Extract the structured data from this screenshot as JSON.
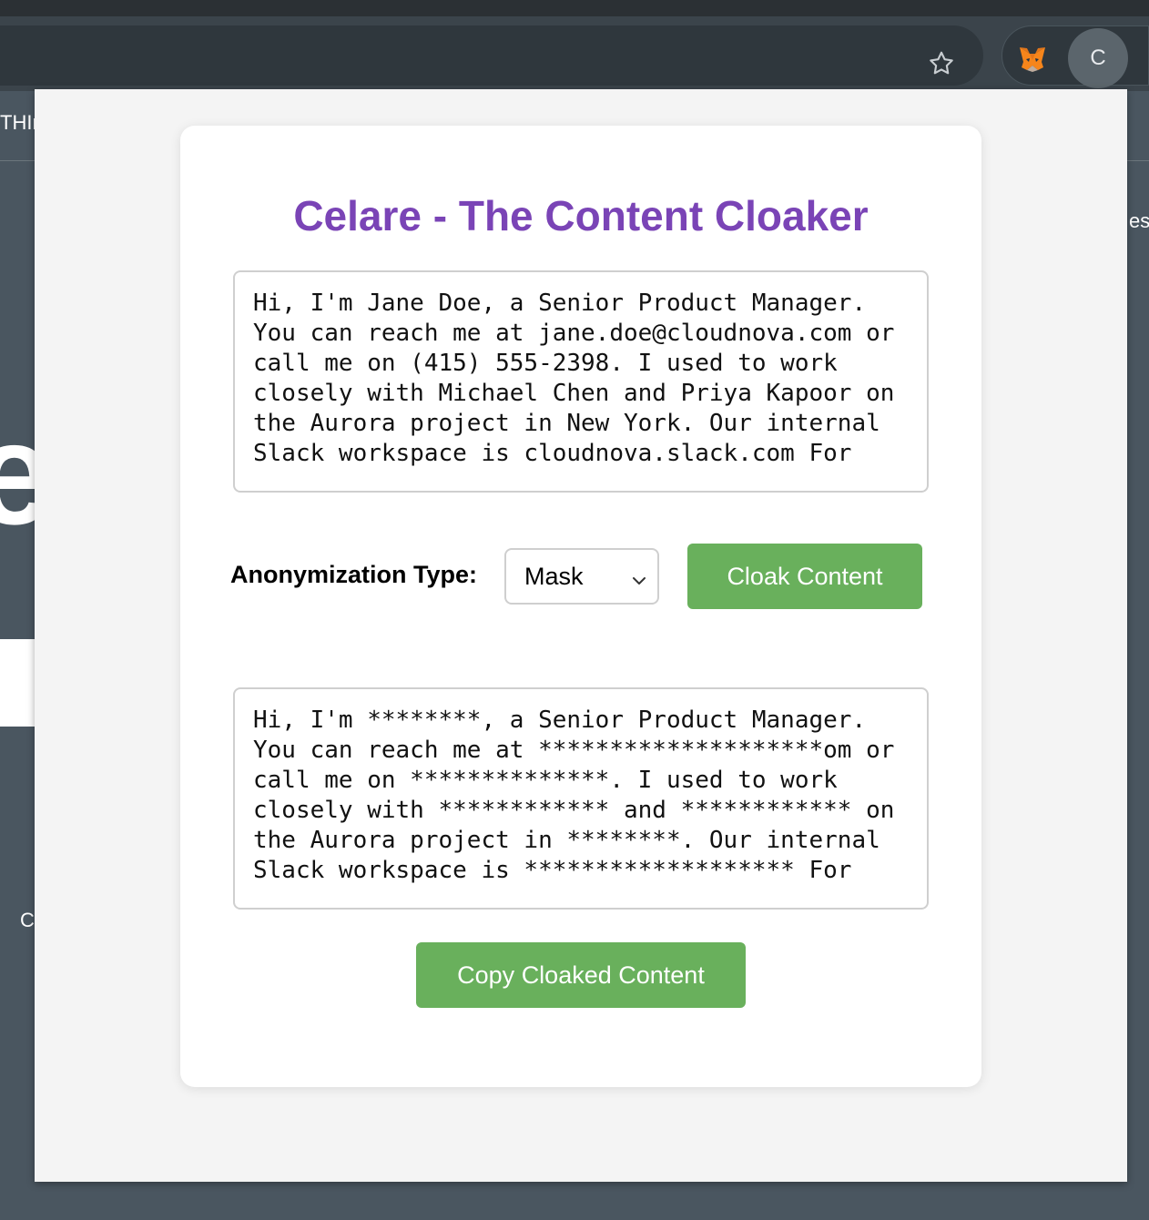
{
  "browser": {
    "avatar_initial": "C",
    "colors": {
      "toolbar": "#3b444b",
      "omnibox": "#2f373d"
    }
  },
  "background": {
    "frag_top_left": "THIr",
    "frag_right": "es",
    "frag_big": "e",
    "frag_bottom_left": "C"
  },
  "app": {
    "title": "Celare - The Content Cloaker",
    "input_text": "Hi, I'm Jane Doe, a Senior Product Manager. You can reach me at jane.doe@cloudnova.com or call me on (415) 555-2398. I used to work closely with Michael Chen and Priya Kapoor on the Aurora project in New York. Our internal Slack workspace is cloudnova.slack.com For",
    "anonymization_label": "Anonymization Type:",
    "anonymization_selected": "Mask",
    "cloak_button": "Cloak Content",
    "output_text": "Hi, I'm ********, a Senior Product Manager. You can reach me at ********************om or call me on **************. I used to work closely with ************ and ************ on the Aurora project in ********. Our internal Slack workspace is ******************* For",
    "copy_button": "Copy Cloaked Content",
    "colors": {
      "title": "#7a44b6",
      "button": "#69b05c",
      "card": "#ffffff"
    }
  }
}
